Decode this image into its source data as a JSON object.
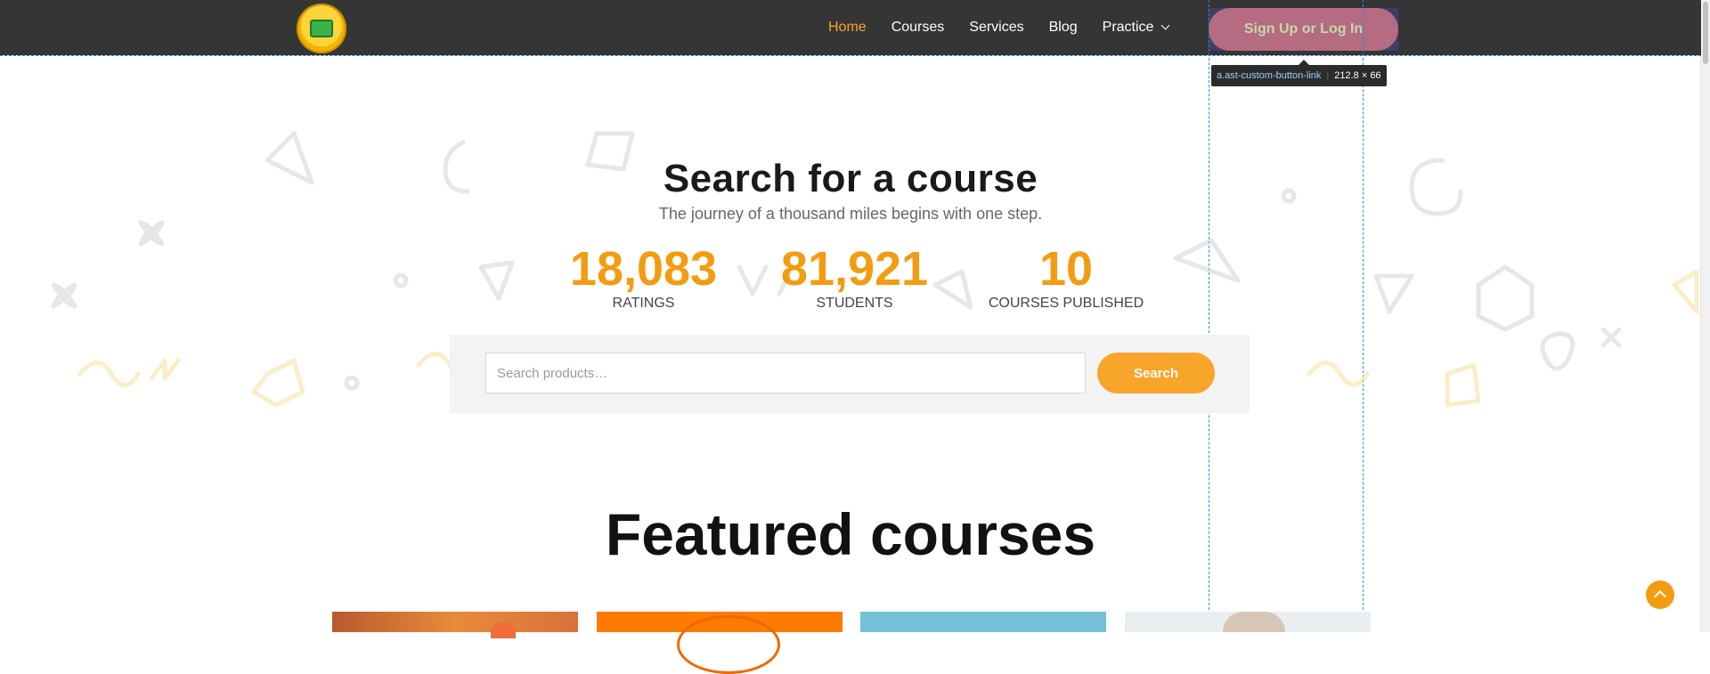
{
  "header": {
    "logo_name": "coin-logo",
    "nav": [
      {
        "label": "Home",
        "active": true
      },
      {
        "label": "Courses",
        "active": false
      },
      {
        "label": "Services",
        "active": false
      },
      {
        "label": "Blog",
        "active": false
      },
      {
        "label": "Practice",
        "active": false,
        "has_dropdown": true
      }
    ],
    "signup_label": "Sign Up or Log In"
  },
  "devtools_tooltip": {
    "selector": "a.ast-custom-button-link",
    "size": "212.8 × 66"
  },
  "hero": {
    "title": "Search for a course",
    "subtitle": "The journey of a thousand miles begins with one step.",
    "stats": [
      {
        "value": "18,083",
        "label": "RATINGS"
      },
      {
        "value": "81,921",
        "label": "STUDENTS"
      },
      {
        "value": "10",
        "label": "COURSES PUBLISHED"
      }
    ]
  },
  "search": {
    "placeholder": "Search products…",
    "value": "",
    "button_label": "Search"
  },
  "featured": {
    "title": "Featured courses"
  },
  "colors": {
    "accent": "#f39c12",
    "header_bg": "#353535",
    "signup_bg": "#b56b82"
  },
  "icons": [
    "chevron-down-icon",
    "arrow-up-icon"
  ]
}
